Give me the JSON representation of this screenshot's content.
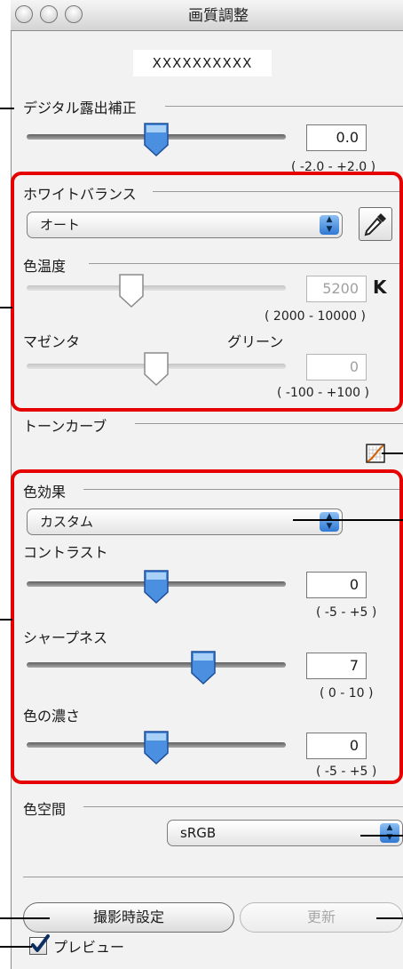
{
  "window": {
    "title": "画質調整",
    "name": "XXXXXXXXXX"
  },
  "exposure": {
    "label": "デジタル露出補正",
    "value": "0.0",
    "range": "( -2.0 - +2.0 )",
    "level": 0.5
  },
  "white_balance": {
    "label": "ホワイトバランス",
    "selected": "オート",
    "color_temp": {
      "label": "色温度",
      "value": "5200",
      "unit": "K",
      "range": "( 2000 - 10000 )",
      "level": 0.4
    },
    "magenta_label": "マゼンタ",
    "green_label": "グリーン",
    "tint": {
      "value": "0",
      "range": "( -100 - +100 )",
      "level": 0.5
    }
  },
  "tone_curve": {
    "label": "トーンカーブ"
  },
  "color_effect": {
    "label": "色効果",
    "selected": "カスタム",
    "contrast": {
      "label": "コントラスト",
      "value": "0",
      "range": "( -5 - +5 )",
      "level": 0.5
    },
    "sharpness": {
      "label": "シャープネス",
      "value": "7",
      "range": "( 0 - 10 )",
      "level": 0.7
    },
    "saturation": {
      "label": "色の濃さ",
      "value": "0",
      "range": "( -5 - +5 )",
      "level": 0.5
    }
  },
  "color_space": {
    "label": "色空間",
    "selected": "sRGB"
  },
  "buttons": {
    "shot_settings": "撮影時設定",
    "update": "更新"
  },
  "preview": {
    "label": "プレビュー",
    "checked": true
  },
  "colors": {
    "highlight": "#e60000",
    "thumb_active": "#4a8fe0",
    "thumb_disabled": "#ffffff"
  },
  "icons": [
    "eyedropper-icon",
    "tone-curve-icon",
    "checkmark-icon"
  ]
}
